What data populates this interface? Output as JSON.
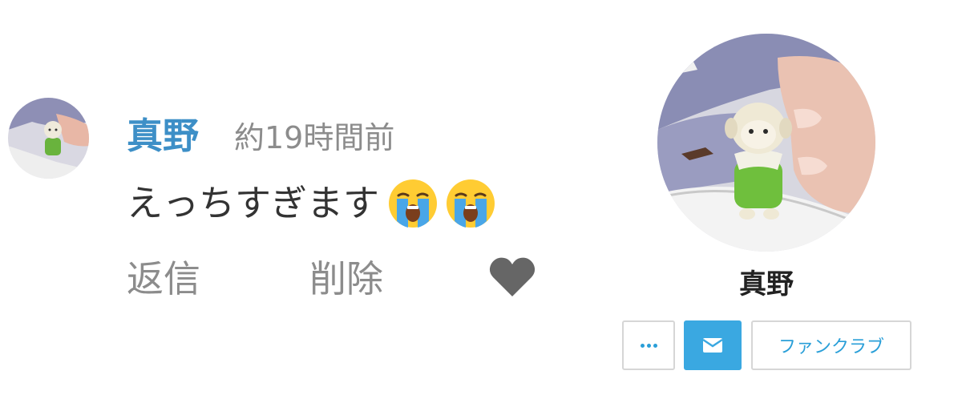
{
  "comment": {
    "author": "真野",
    "time": "約19時間前",
    "text": "えっちすぎます",
    "emojis": [
      "loudly-crying-face-emoji",
      "loudly-crying-face-emoji"
    ],
    "actions": {
      "reply_label": "返信",
      "delete_label": "削除",
      "like_icon": "heart-icon"
    }
  },
  "profile": {
    "name": "真野",
    "buttons": {
      "more_icon": "more-dots-icon",
      "mail_icon": "envelope-icon",
      "fanclub_label": "ファンクラブ"
    }
  },
  "colors": {
    "author_link": "#3d8fc7",
    "muted_text": "#8c8c8c",
    "body_text": "#333333",
    "accent": "#3aa8e1",
    "heart": "#666666"
  }
}
